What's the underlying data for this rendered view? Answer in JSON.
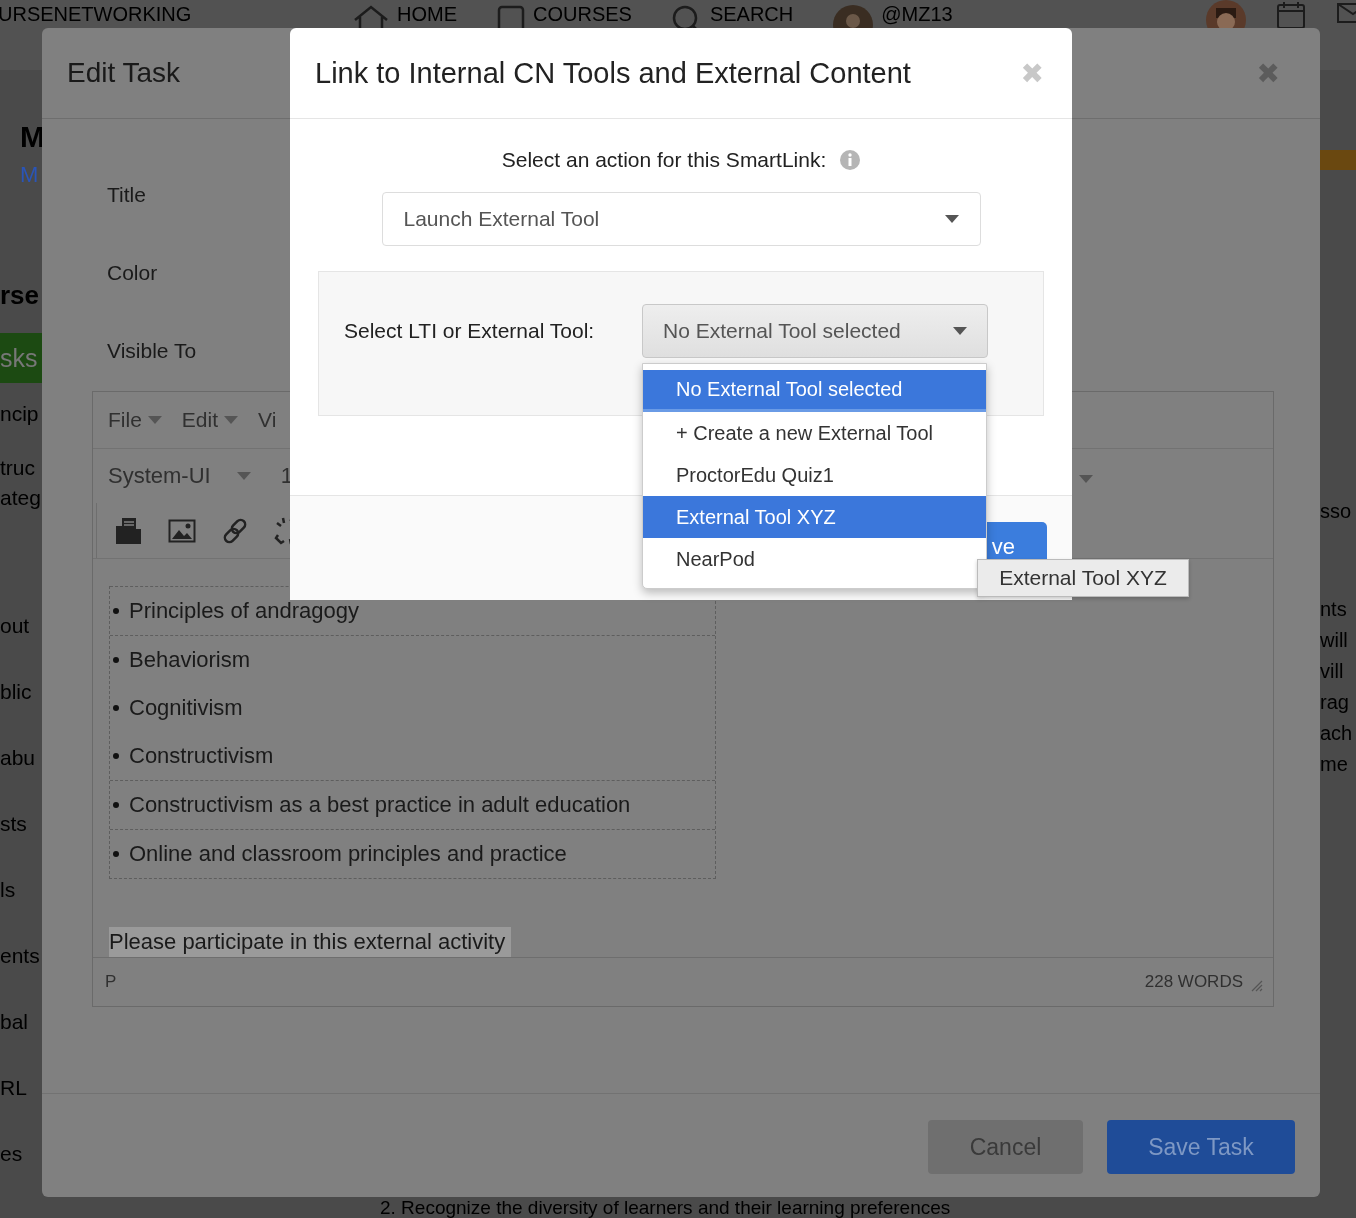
{
  "background_page": {
    "brand": "URSENETWORKING",
    "nav": [
      "HOME",
      "COURSES",
      "SEARCH",
      "@MZ13"
    ],
    "banner": {
      "level": 1
    },
    "course_title": "M",
    "course_link": "M",
    "sidebar_items": [
      {
        "label": "rse",
        "kind": "heading",
        "selected": false
      },
      {
        "label": "sks",
        "kind": "tab",
        "selected": true
      },
      {
        "label": "ncip",
        "kind": "line",
        "selected": false
      },
      {
        "label": "truc",
        "kind": "line",
        "selected": false
      },
      {
        "label": "ateg",
        "kind": "line",
        "selected": false
      },
      {
        "label": "out",
        "kind": "item",
        "selected": false
      },
      {
        "label": "blic",
        "kind": "item",
        "selected": false
      },
      {
        "label": "abu",
        "kind": "item",
        "selected": false
      },
      {
        "label": "sts",
        "kind": "item",
        "selected": false
      },
      {
        "label": "ls",
        "kind": "item",
        "selected": false
      },
      {
        "label": "ents",
        "kind": "item",
        "selected": false
      },
      {
        "label": "bal",
        "kind": "item",
        "selected": false
      },
      {
        "label": "RL",
        "kind": "item",
        "selected": false
      },
      {
        "label": "es",
        "kind": "item",
        "selected": false
      }
    ],
    "right_heading": "sso",
    "right_lines": [
      "nts",
      "will",
      "vill",
      "rag",
      "ach",
      "me"
    ],
    "bottom_text": "2. Recognize the diversity of learners and their learning preferences"
  },
  "edit_task": {
    "title": "Edit Task",
    "close": "✖",
    "fields": [
      "Title",
      "Color",
      "Visible To"
    ],
    "editor": {
      "menu": [
        "File",
        "Edit",
        "Vi"
      ],
      "font": "System-UI",
      "size": "1",
      "list_rows": [
        [
          "Principles of andragogy"
        ],
        [
          "Behaviorism",
          "Cognitivism",
          "Constructivism"
        ],
        [
          "Constructivism as a best practice in adult education"
        ],
        [
          "Online and classroom principles and practice"
        ]
      ],
      "highlighted_text": "Please participate in this external activity",
      "path": "P",
      "word_count": "228 WORDS"
    },
    "buttons": [
      {
        "label": "Cancel",
        "kind": "secondary"
      },
      {
        "label": "Save Task",
        "kind": "primary"
      }
    ]
  },
  "link_dialog": {
    "title": "Link to Internal CN Tools and External Content",
    "close": "✖",
    "action_label": "Select an action for this SmartLink:",
    "action_value": "Launch External Tool",
    "tool_label": "Select LTI or External Tool:",
    "tool_value": "No External Tool selected",
    "save_button": "ve",
    "options": [
      {
        "label": "No External Tool selected",
        "selected": true,
        "hovered": false
      },
      {
        "label": "+ Create a new External Tool",
        "selected": false,
        "hovered": false
      },
      {
        "label": "ProctorEdu Quiz1",
        "selected": false,
        "hovered": false
      },
      {
        "label": "External Tool XYZ",
        "selected": false,
        "hovered": true
      },
      {
        "label": "NearPod",
        "selected": false,
        "hovered": false
      }
    ],
    "tooltip": "External Tool XYZ"
  }
}
